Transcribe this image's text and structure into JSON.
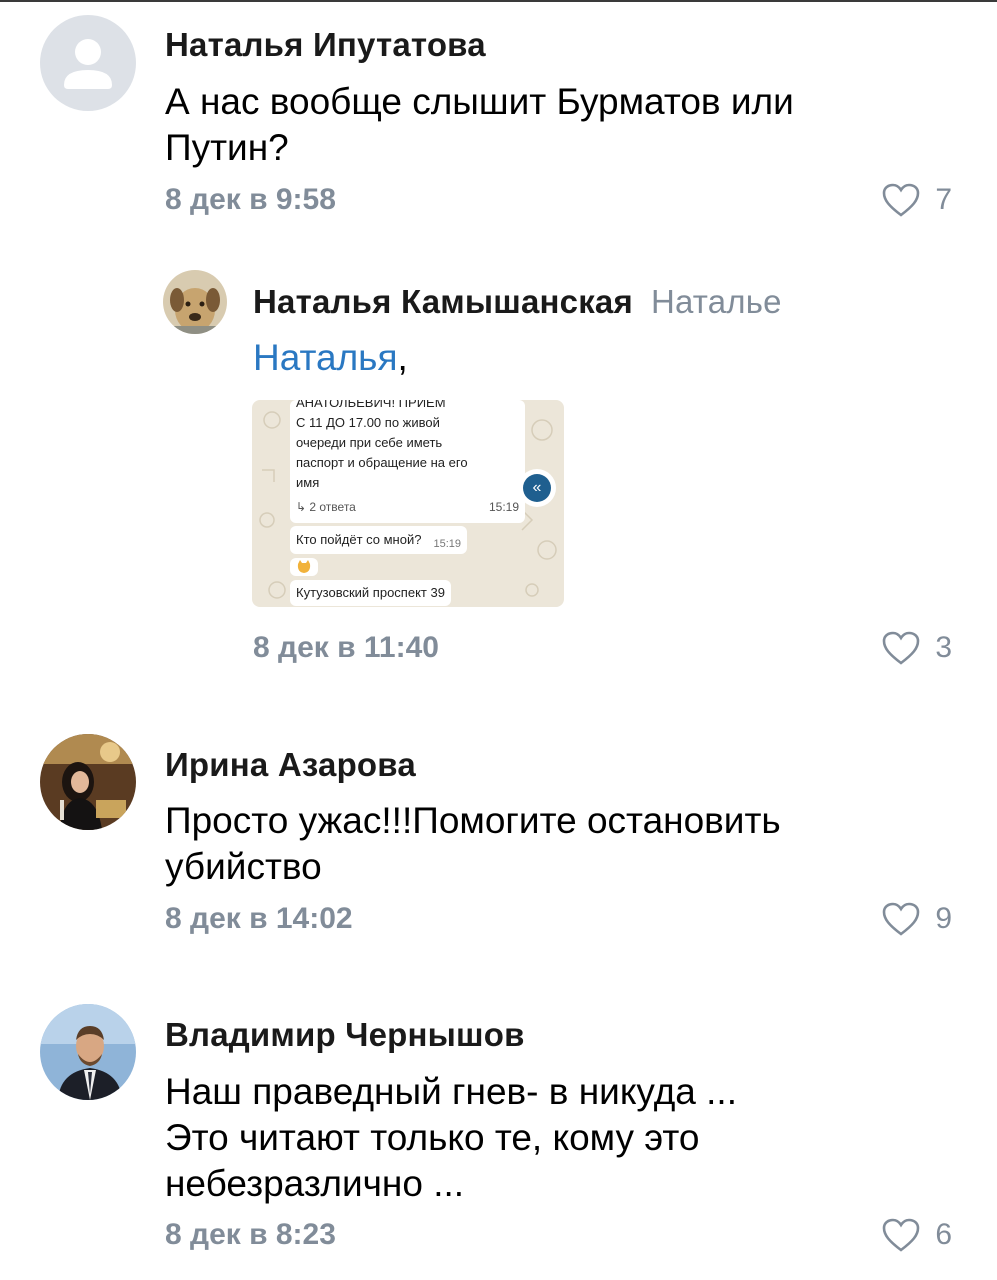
{
  "comments": [
    {
      "author": "Наталья Ипутатова",
      "text": "А нас вообще слышит Бурматов или Путин?",
      "time": "8 дек в 9:58",
      "likes": "7",
      "avatar": "placeholder-avatar"
    },
    {
      "author": "Наталья Камышанская",
      "reply_to": "Наталье",
      "mention": "Наталья",
      "mention_suffix": ",",
      "time": "8 дек в 11:40",
      "likes": "3",
      "avatar": "dog-photo-avatar",
      "attachment": {
        "lines": [
          "АНАТОЛЬЕВИЧ! ПРИЕМ",
          "С 11 ДО 17.00 по живой",
          "очереди при себе иметь",
          "паспорт и обращение на его",
          "имя"
        ],
        "replies": "↳ 2 ответа",
        "replies_time": "15:19",
        "msg2": "Кто пойдёт со мной?",
        "msg2_time": "15:19",
        "msg3": "Кутузовский проспект 39",
        "forward_icon": "«"
      }
    },
    {
      "author": "Ирина Азарова",
      "text": "Просто ужас!!!Помогите остановить убийство",
      "time": "8 дек в 14:02",
      "likes": "9",
      "avatar": "woman-photo-avatar"
    },
    {
      "author": "Владимир Чернышов",
      "text_lines": [
        "Наш праведный гнев- в никуда ...",
        "Это читают только те, кому это",
        "небезразлично ..."
      ],
      "time": "8 дек в 8:23",
      "likes": "6",
      "avatar": "man-photo-avatar"
    }
  ],
  "colors": {
    "secondary": "#818c99",
    "link": "#2a78c2",
    "placeholder_avatar": "#dde1e7"
  }
}
